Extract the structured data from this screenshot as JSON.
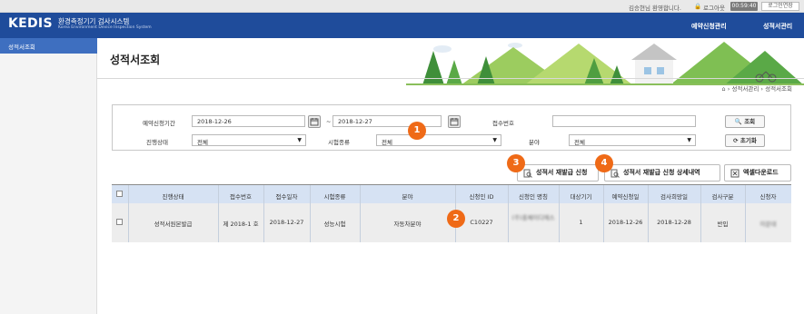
{
  "topbar": {
    "welcome": "김승현님 환영합니다.",
    "logout": "로그아웃",
    "timer": "00:59:40",
    "extend": "로그인연장"
  },
  "header": {
    "logo": "KEDIS",
    "title": "환경측정기기 검사시스템",
    "subtitle": "Korea Environment Device Inspection System",
    "nav": [
      "예약신청관리",
      "성적서관리"
    ]
  },
  "sidebar": {
    "items": [
      {
        "label": "성적서조회"
      }
    ]
  },
  "page": {
    "title": "성적서조회",
    "breadcrumb": [
      "성적서관리",
      "성적서조회"
    ]
  },
  "search": {
    "period_label": "예약신청기간",
    "date_from": "2018-12-26",
    "tilde": "~",
    "date_to": "2018-12-27",
    "receipt_label": "접수번호",
    "receipt_value": "",
    "status_label": "진행상태",
    "status_value": "전체",
    "type_label": "시험종류",
    "type_value": "전체",
    "field_label": "분야",
    "field_value": "전체",
    "search_button": "조회",
    "reset_button": "초기화"
  },
  "actions": {
    "reissue": "성적서 재발급 신청",
    "reissue_detail": "성적서 재발급 신청 상세내역",
    "excel": "엑셀다운로드"
  },
  "badges": [
    "1",
    "2",
    "3",
    "4"
  ],
  "table": {
    "columns": [
      "진행상태",
      "접수번호",
      "접수일자",
      "시험종류",
      "분야",
      "신청인 ID",
      "신청인 명칭",
      "대상기기",
      "예약신청일",
      "검사희망일",
      "검사구분",
      "신청자"
    ],
    "rows": [
      [
        "성적서원본발급",
        "제 2018-1 호",
        "2018-12-27",
        "성능시험",
        "자동차분야",
        "C10227",
        "(주)홍체이디에스",
        "1",
        "2018-12-26",
        "2018-12-28",
        "반입",
        "이문대"
      ]
    ]
  },
  "colors": {
    "header": "#1f4c9b",
    "sidebar_active": "#3e6fc0",
    "badge": "#ef6a17",
    "table_head": "#d6e2f3"
  }
}
